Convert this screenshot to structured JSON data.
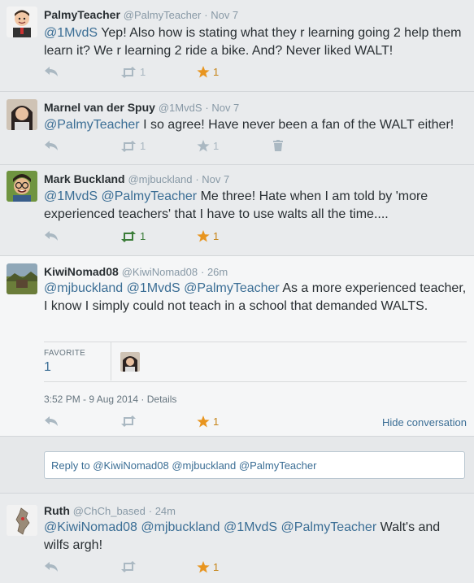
{
  "tweets": [
    {
      "name": "PalmyTeacher",
      "handle": "@PalmyTeacher",
      "time": "· Nov 7",
      "text_parts": [
        {
          "t": "@1MvdS",
          "m": true
        },
        {
          "t": " Yep! Also how is stating what they r learning going 2 help them learn it? We r learning 2 ride a bike. And? Never liked WALT!",
          "m": false
        }
      ],
      "retweets": "1",
      "favorites": "1"
    },
    {
      "name": "Marnel van der Spuy",
      "handle": "@1MvdS",
      "time": "· Nov 7",
      "text_parts": [
        {
          "t": "@PalmyTeacher",
          "m": true
        },
        {
          "t": " I so agree! Have never been a fan of the WALT either!",
          "m": false
        }
      ],
      "retweets": "1",
      "favorites": "1"
    },
    {
      "name": "Mark Buckland",
      "handle": "@mjbuckland",
      "time": "· Nov 7",
      "text_parts": [
        {
          "t": "@1MvdS",
          "m": true
        },
        {
          "t": " ",
          "m": false
        },
        {
          "t": "@PalmyTeacher",
          "m": true
        },
        {
          "t": " Me three! Hate when I am told by 'more experienced teachers' that I have to use walts all the time....",
          "m": false
        }
      ],
      "retweets": "1",
      "favorites": "1"
    },
    {
      "name": "KiwiNomad08",
      "handle": "@KiwiNomad08",
      "time": "· 26m",
      "text_parts": [
        {
          "t": "@mjbuckland",
          "m": true
        },
        {
          "t": " ",
          "m": false
        },
        {
          "t": "@1MvdS",
          "m": true
        },
        {
          "t": " ",
          "m": false
        },
        {
          "t": "@PalmyTeacher",
          "m": true
        },
        {
          "t": " As a more experienced teacher, I know I simply could not teach in a school that demanded WALTS.",
          "m": false
        }
      ],
      "favorite_label": "FAVORITE",
      "favorite_count": "1",
      "timestamp": "3:52 PM - 9 Aug 2014 · Details",
      "favorites": "1",
      "hide_label": "Hide conversation"
    },
    {
      "name": "Ruth",
      "handle": "@ChCh_based",
      "time": "· 24m",
      "text_parts": [
        {
          "t": "@KiwiNomad08",
          "m": true
        },
        {
          "t": " ",
          "m": false
        },
        {
          "t": "@mjbuckland",
          "m": true
        },
        {
          "t": " ",
          "m": false
        },
        {
          "t": "@1MvdS",
          "m": true
        },
        {
          "t": " ",
          "m": false
        },
        {
          "t": "@PalmyTeacher",
          "m": true
        },
        {
          "t": " Walt's and wilfs argh!",
          "m": false
        }
      ],
      "favorites": "1"
    }
  ],
  "reply_box": {
    "text": "Reply to @KiwiNomad08 @mjbuckland @PalmyTeacher"
  },
  "colors": {
    "mention": "#3b6e95",
    "favorite_star": "#e8951f",
    "retweet_active": "#3a7c38",
    "icon_gray": "#aab8c2"
  }
}
